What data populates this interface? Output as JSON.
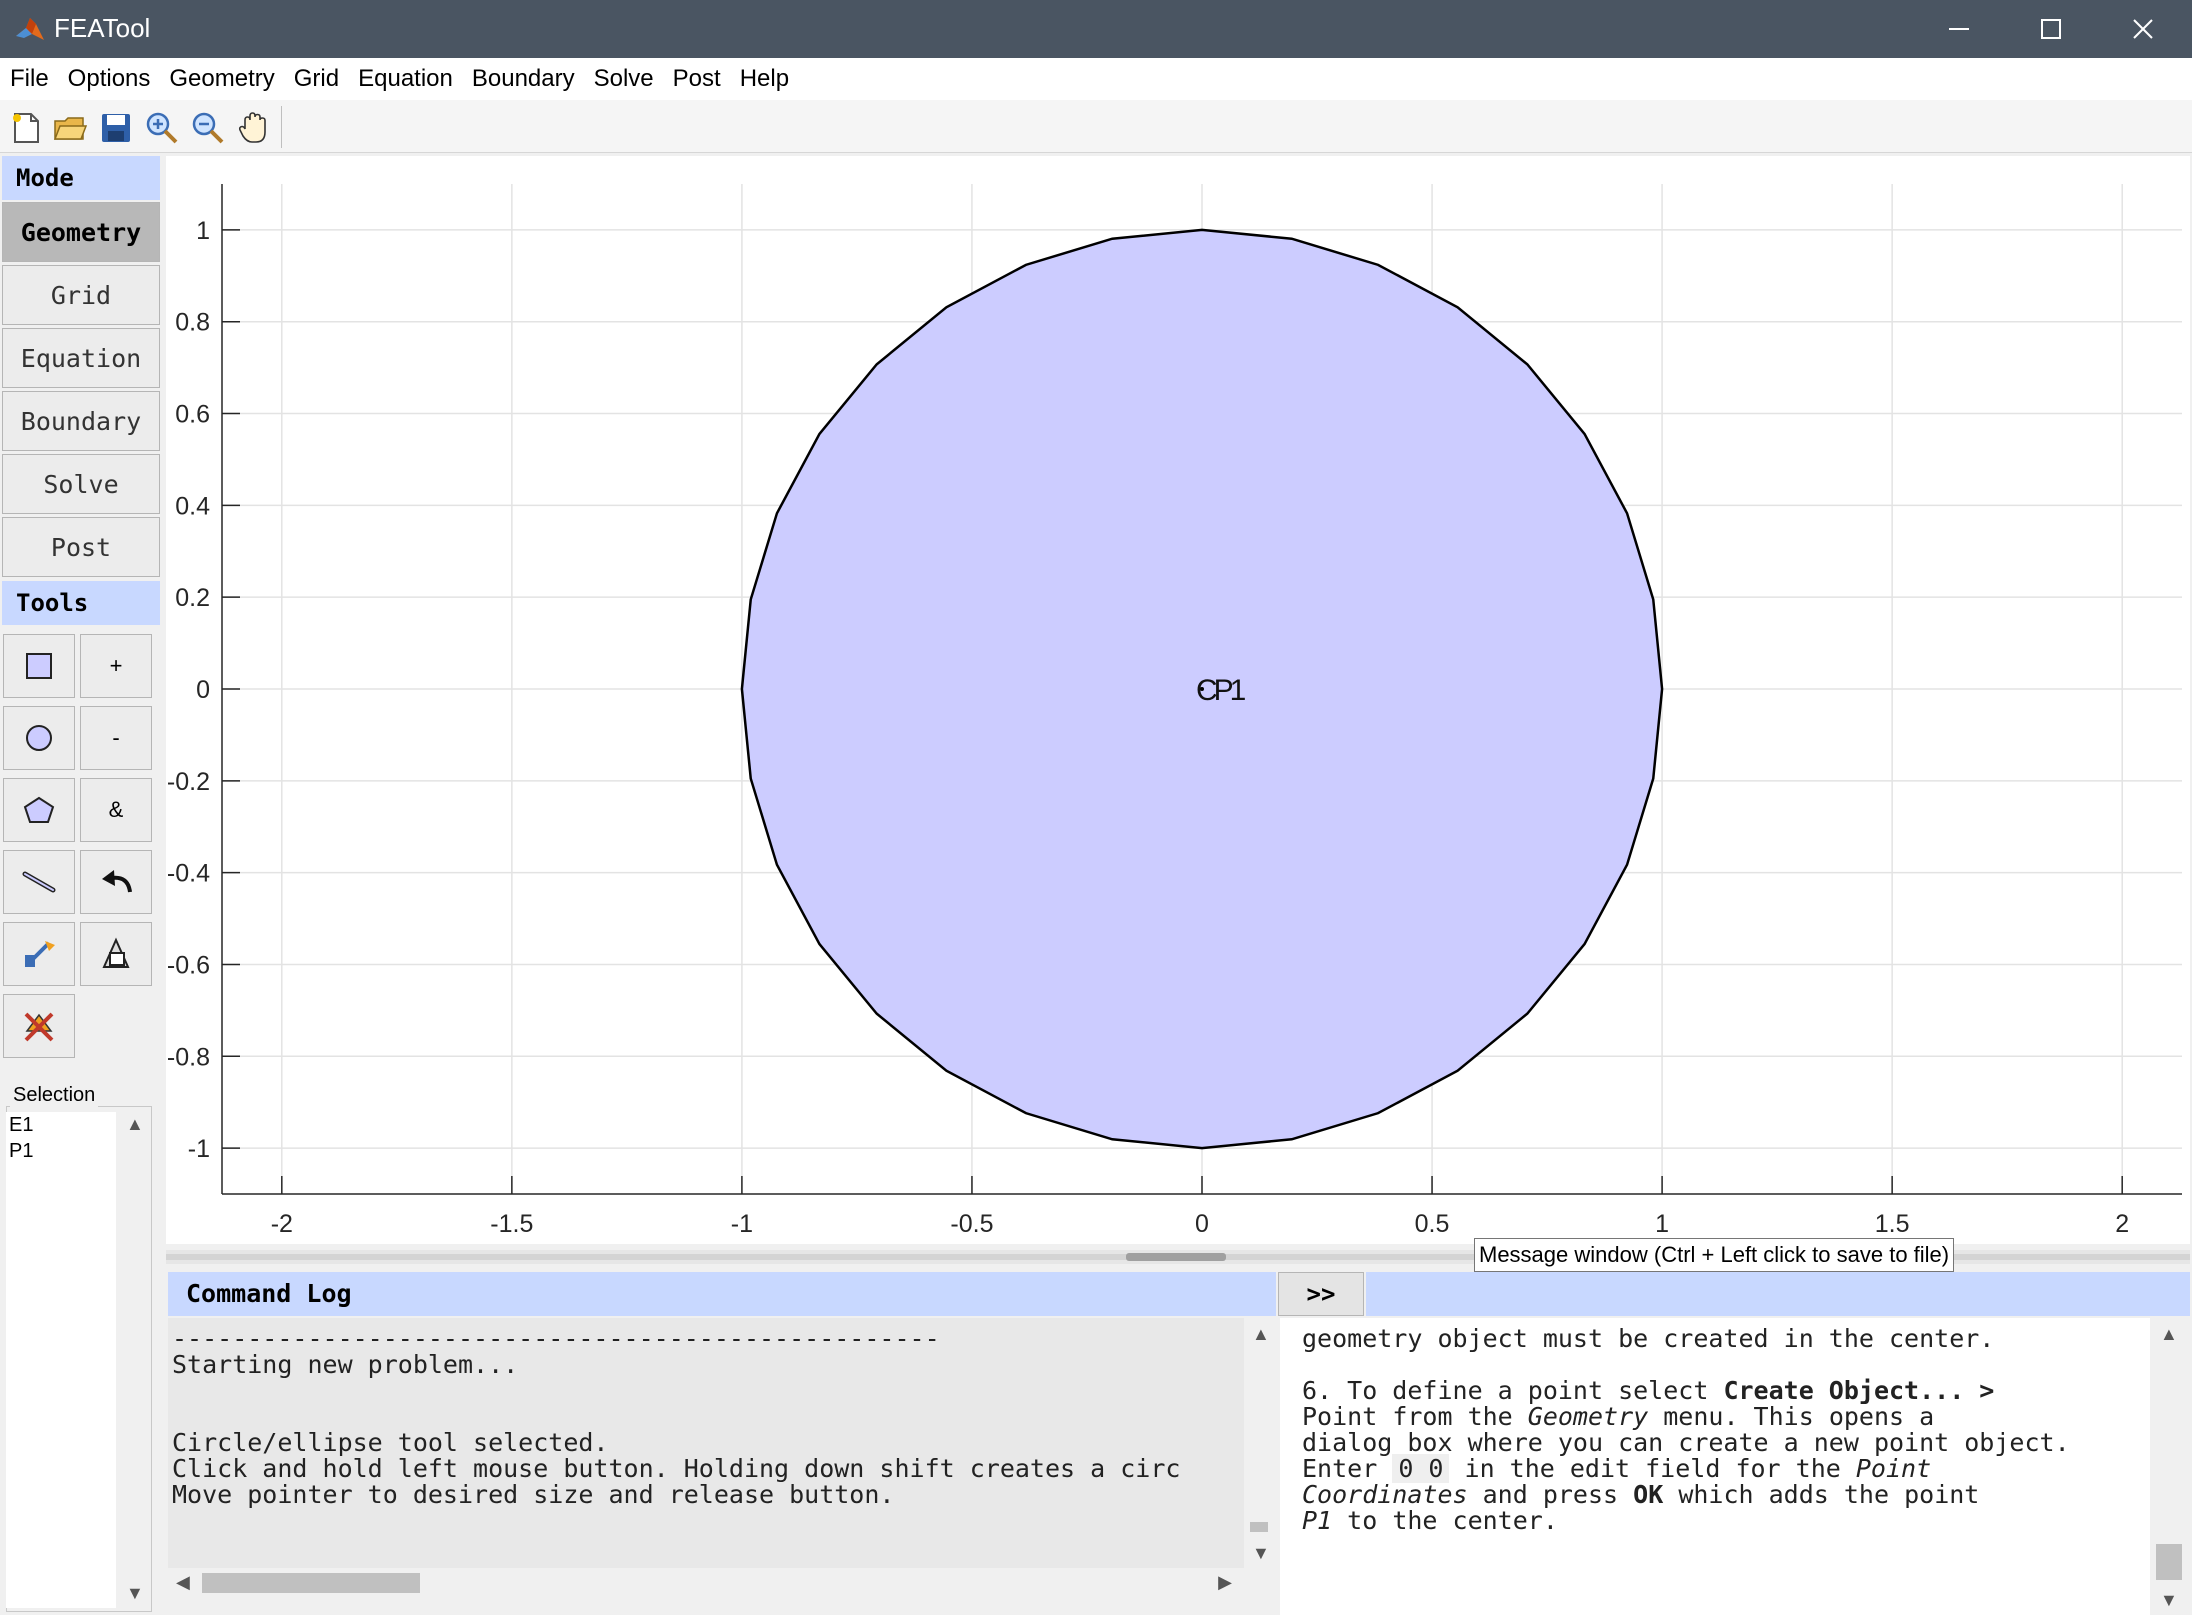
{
  "window": {
    "title": "FEATool",
    "logo_icon": "matlab-membrane-icon"
  },
  "menu": [
    "File",
    "Options",
    "Geometry",
    "Grid",
    "Equation",
    "Boundary",
    "Solve",
    "Post",
    "Help"
  ],
  "toolbar": {
    "icons": [
      "new-file-icon",
      "open-folder-icon",
      "save-icon",
      "zoom-in-icon",
      "zoom-out-icon",
      "pan-hand-icon"
    ]
  },
  "mode": {
    "header": "Mode",
    "buttons": [
      "Geometry",
      "Grid",
      "Equation",
      "Boundary",
      "Solve",
      "Post"
    ],
    "active": "Geometry"
  },
  "tools": {
    "header": "Tools",
    "plus_label": "+",
    "minus_label": "-",
    "intersect_label": "&",
    "icons": [
      "rectangle-icon",
      "circle-icon",
      "polygon-icon",
      "line-icon",
      "undo-icon",
      "edit-object-icon",
      "transform-icon",
      "delete-icon"
    ]
  },
  "selection": {
    "label": "Selection",
    "items": [
      "E1",
      "P1"
    ]
  },
  "plot": {
    "object_label": "CP1",
    "face_color": "#ccccff",
    "edge_color": "#000000"
  },
  "chart_data": {
    "type": "scatter",
    "title": "",
    "xlabel": "",
    "ylabel": "",
    "xlim": [
      -2.13,
      2.13
    ],
    "ylim": [
      -1.1,
      1.1
    ],
    "x_ticks": [
      -2,
      -1.5,
      -1,
      -0.5,
      0,
      0.5,
      1,
      1.5,
      2
    ],
    "x_tick_labels": [
      "-2",
      "-1.5",
      "-1",
      "-0.5",
      "0",
      "0.5",
      "1",
      "1.5",
      "2"
    ],
    "y_ticks": [
      1,
      0.8,
      0.6,
      0.4,
      0.2,
      0,
      -0.2,
      -0.4,
      -0.6,
      -0.8,
      -1
    ],
    "y_tick_labels": [
      "1",
      "0.8",
      "0.6",
      "0.4",
      "0.2",
      "0",
      "-0.2",
      "-0.4",
      "-0.6",
      "-0.8",
      "-1"
    ],
    "grid": true,
    "shapes": [
      {
        "type": "circle",
        "center": [
          0,
          0
        ],
        "radius": 1,
        "segments": 32
      }
    ],
    "points": [
      {
        "x": 0,
        "y": 0
      }
    ]
  },
  "command_log": {
    "header": "Command Log",
    "expand_label": ">>",
    "lines": [
      "---------------------------------------------------",
      "Starting new problem...",
      "",
      "",
      "Circle/ellipse tool selected.",
      "Click and hold left mouse button. Holding down shift creates a circ",
      "Move pointer to desired size and release button."
    ]
  },
  "help": {
    "l1": "geometry object must be created in the center.",
    "l2a": "6. To define a point select ",
    "l2b": "Create Object... >",
    "l3a": "Point",
    "l3b": " from the ",
    "l3c": "Geometry",
    "l3d": " menu. This opens a",
    "l4": "dialog box where you can create a new point object.",
    "l5a": "Enter ",
    "l5b": "0 0",
    "l5c": " in the edit field for the ",
    "l5d": "Point",
    "l6a": "Coordinates",
    "l6b": " and press ",
    "l6c": "OK",
    "l6d": " which adds the point",
    "l7a": "P1",
    "l7b": " to the center."
  },
  "tooltip": "Message window (Ctrl + Left click to save to file)"
}
